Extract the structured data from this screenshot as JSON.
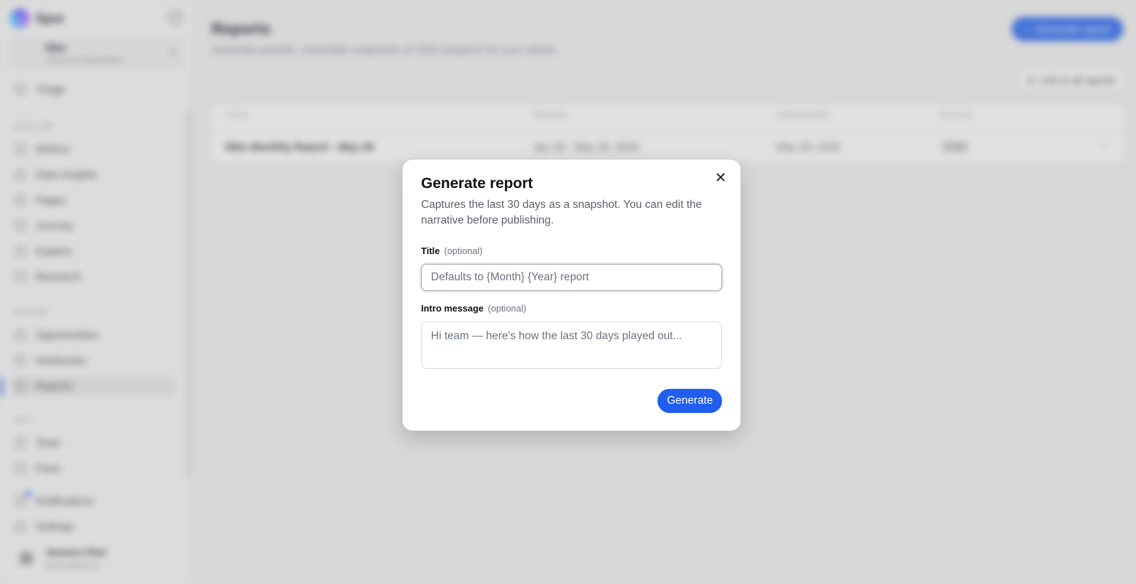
{
  "sidebar": {
    "brand": "Spur",
    "org": {
      "name": "Nike",
      "sub": "Jessica's Organization"
    },
    "items": {
      "triage": "Triage",
      "metrics": "Metrics",
      "data_insights": "Data insights",
      "pages": "Pages",
      "journey": "Journey",
      "explore": "Explore",
      "research": "Research",
      "opportunities": "Opportunities",
      "notebooks": "Notebooks",
      "reports": "Reports",
      "tests": "Tests",
      "fixes": "Fixes",
      "notifications": "Notifications",
      "settings": "Settings"
    },
    "sections": {
      "analyze": "ANALYZE",
      "decide": "DECIDE",
      "act": "ACT"
    },
    "user": {
      "name": "Jessica Choi",
      "email": "jessica@spur.ai"
    }
  },
  "main": {
    "title": "Reports",
    "subtitle": "Generate periodic, shareable snapshots of CRO progress for your clients",
    "generate_label": "Generate report",
    "generate_icon": "plus-icon",
    "link_label": "Link to all reports",
    "link_icon": "copy-icon",
    "table": {
      "headers": [
        "TITLE",
        "PERIOD",
        "GENERATED",
        "STATUS"
      ],
      "rows": [
        {
          "title": "Nike Monthly Report - May 28",
          "period": "Apr 28 - May 28, 2026",
          "generated": "May 28, 2026",
          "status": "Draft"
        }
      ]
    }
  },
  "modal": {
    "title": "Generate report",
    "description": "Captures the last 30 days as a snapshot. You can edit the narrative before publishing.",
    "title_field": {
      "label": "Title",
      "optional": "(optional)",
      "placeholder": "Defaults to {Month} {Year} report",
      "value": ""
    },
    "intro_field": {
      "label": "Intro message",
      "optional": "(optional)",
      "placeholder": "Hi team — here's how the last 30 days played out...",
      "value": ""
    },
    "submit_label": "Generate",
    "close_icon": "close-icon"
  },
  "colors": {
    "accent": "#1f5ef0",
    "active_bar": "#2563eb"
  }
}
